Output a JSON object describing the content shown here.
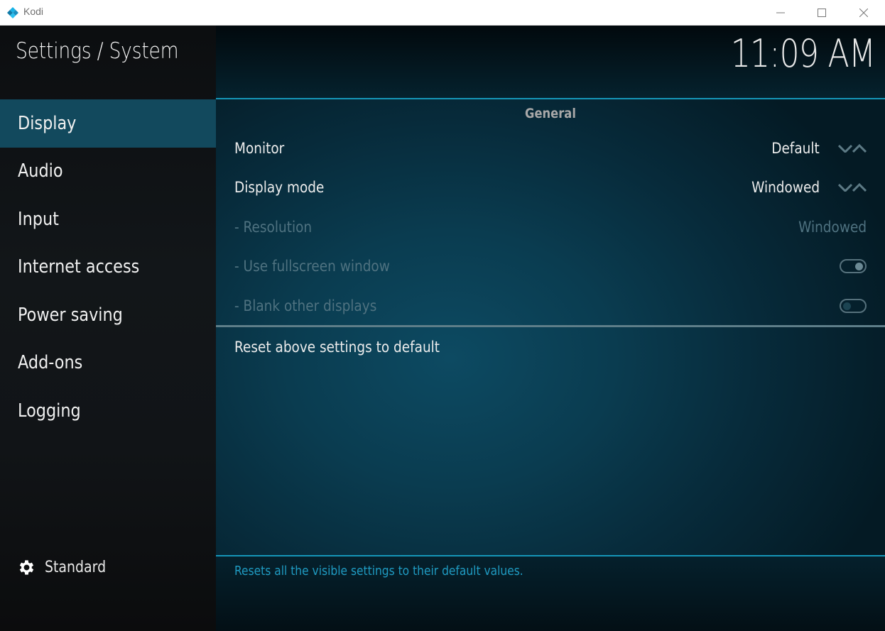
{
  "window": {
    "title": "Kodi",
    "icon": "kodi-logo-icon",
    "controls": [
      "minimize",
      "maximize",
      "close"
    ]
  },
  "header": {
    "title": "Settings / System",
    "clock": "11:09 AM"
  },
  "sidebar": {
    "items": [
      {
        "label": "Display",
        "active": true
      },
      {
        "label": "Audio",
        "active": false
      },
      {
        "label": "Input",
        "active": false
      },
      {
        "label": "Internet access",
        "active": false
      },
      {
        "label": "Power saving",
        "active": false
      },
      {
        "label": "Add-ons",
        "active": false
      },
      {
        "label": "Logging",
        "active": false
      }
    ],
    "settings_level": {
      "icon": "gear-icon",
      "label": "Standard"
    }
  },
  "main": {
    "section_title": "General",
    "settings": [
      {
        "name": "Monitor",
        "value": "Default",
        "control": "spinner",
        "enabled": true
      },
      {
        "name": "Display mode",
        "value": "Windowed",
        "control": "spinner",
        "enabled": true
      },
      {
        "name": "- Resolution",
        "value": "Windowed",
        "control": "text",
        "enabled": false
      },
      {
        "name": "- Use fullscreen window",
        "value": "on",
        "control": "toggle",
        "enabled": false
      },
      {
        "name": "- Blank other displays",
        "value": "off",
        "control": "toggle",
        "enabled": false
      }
    ],
    "reset_label": "Reset above settings to default",
    "description": "Resets all the visible settings to their default values."
  },
  "colors": {
    "accent": "#1596b8",
    "active_item": "#12495d",
    "description_text": "#1f9bc2"
  }
}
